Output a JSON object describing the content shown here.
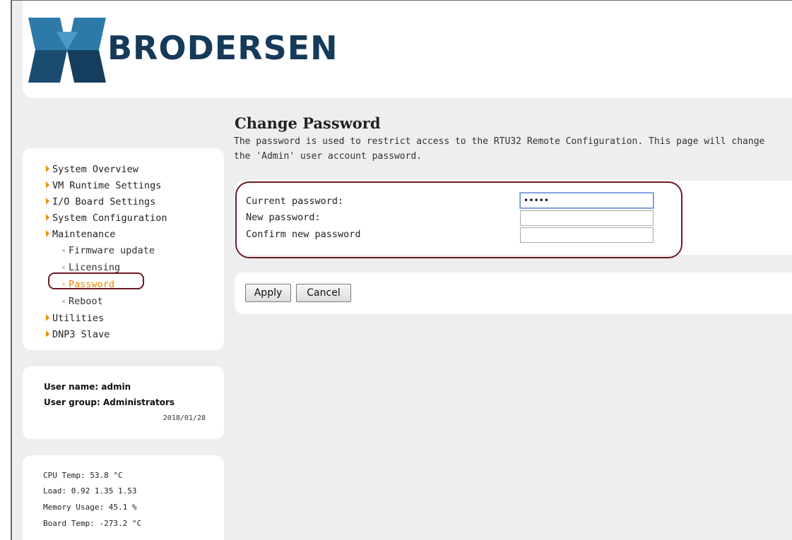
{
  "brand": {
    "name": "BRODERSEN",
    "logo_icon": "brodersen-logo-icon",
    "color": "#163a59"
  },
  "nav": {
    "items": [
      {
        "label": "System Overview",
        "level": 0
      },
      {
        "label": "VM Runtime Settings",
        "level": 0
      },
      {
        "label": "I/O Board Settings",
        "level": 0
      },
      {
        "label": "System Configuration",
        "level": 0
      },
      {
        "label": "Maintenance",
        "level": 0
      },
      {
        "label": "Firmware update",
        "level": 1
      },
      {
        "label": "Licensing",
        "level": 1
      },
      {
        "label": "Password",
        "level": 1,
        "active": true
      },
      {
        "label": "Reboot",
        "level": 1
      },
      {
        "label": "Utilities",
        "level": 0
      },
      {
        "label": "DNP3 Slave",
        "level": 0
      }
    ],
    "accent_color": "#e88a00"
  },
  "user": {
    "name_line": "User name: admin",
    "group_line": "User group: Administrators",
    "date": "2018/01/28"
  },
  "stats": {
    "cpu_temp": "CPU Temp: 53.8 °C",
    "load": "Load: 0.92  1.35  1.53",
    "memory": "Memory Usage: 45.1 %",
    "board_temp": "Board Temp: -273.2 °C"
  },
  "main": {
    "title": "Change Password",
    "description": "The password is used to restrict access to the RTU32 Remote Configuration. This page will change the 'Admin' user account password.",
    "fields": {
      "current_label": "Current password:",
      "current_value": "•••••",
      "new_label": "New password:",
      "new_value": "",
      "confirm_label": "Confirm new password",
      "confirm_value": ""
    },
    "buttons": {
      "apply": "Apply",
      "cancel": "Cancel"
    }
  },
  "highlight_color": "#6b1a26"
}
